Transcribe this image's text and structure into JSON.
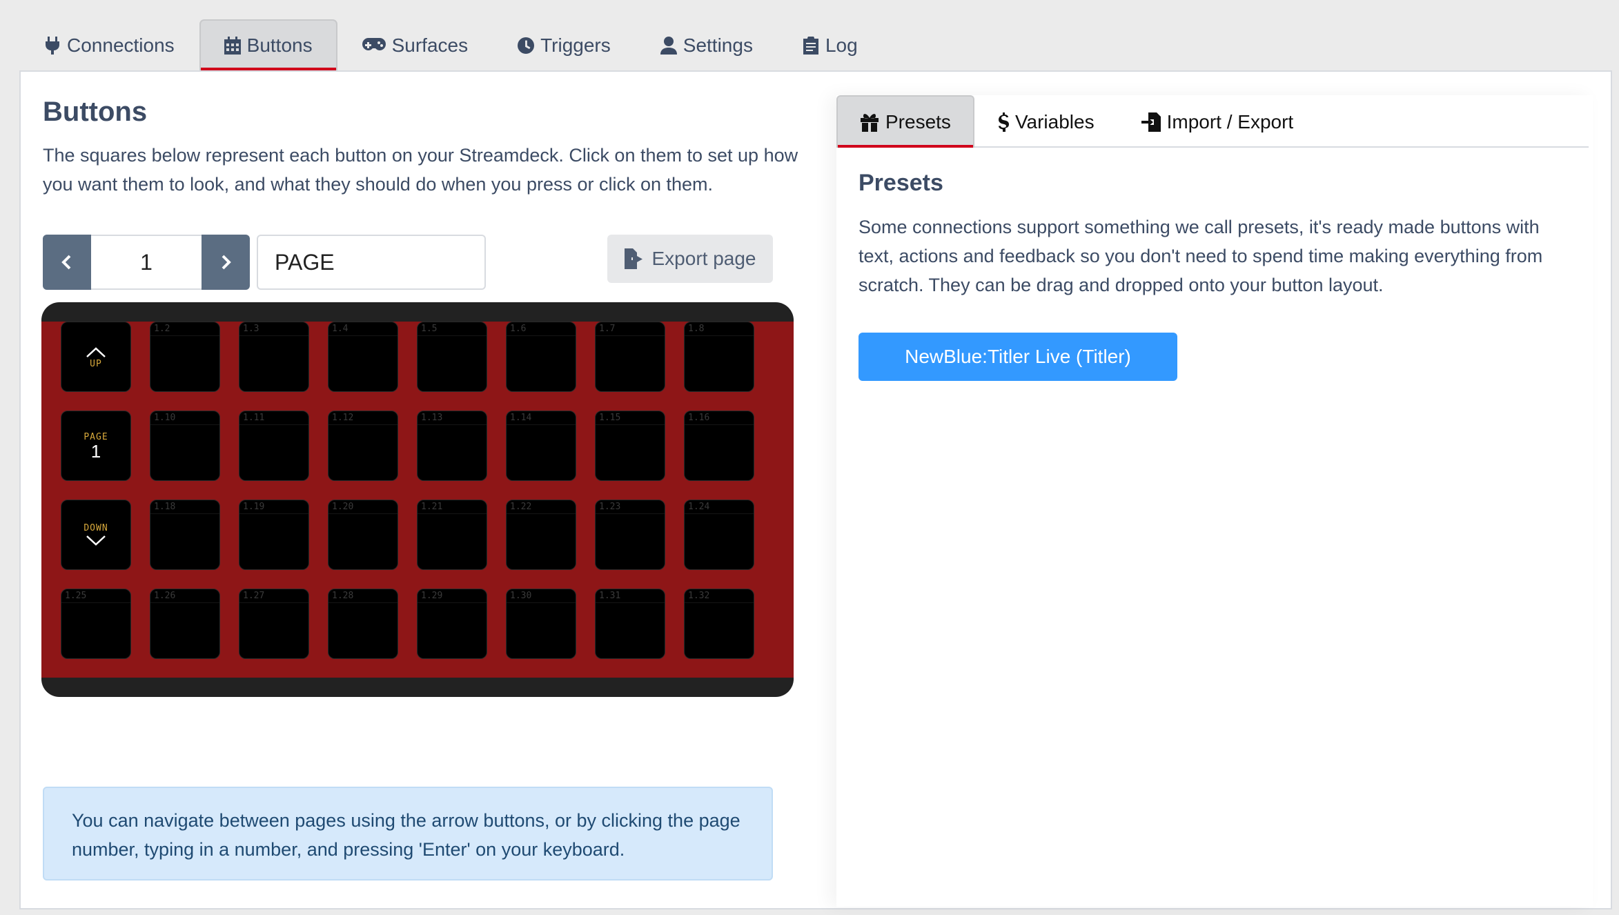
{
  "nav": {
    "tabs": [
      {
        "label": "Connections",
        "icon": "plug-icon",
        "active": false
      },
      {
        "label": "Buttons",
        "icon": "calendar-grid-icon",
        "active": true
      },
      {
        "label": "Surfaces",
        "icon": "gamepad-icon",
        "active": false
      },
      {
        "label": "Triggers",
        "icon": "clock-icon",
        "active": false
      },
      {
        "label": "Settings",
        "icon": "user-cog-icon",
        "active": false
      },
      {
        "label": "Log",
        "icon": "clipboard-icon",
        "active": false
      }
    ]
  },
  "buttons": {
    "title": "Buttons",
    "description": "The squares below represent each button on your Streamdeck. Click on them to set up how you want them to look, and what they should do when you press or click on them.",
    "page_number": "1",
    "page_name": "PAGE",
    "export_label": "Export page",
    "info": "You can navigate between pages using the arrow buttons, or by clicking the page number, typing in a number, and pressing 'Enter' on your keyboard."
  },
  "grid": {
    "up_label": "UP",
    "page_label": "PAGE",
    "page_value": "1",
    "down_label": "DOWN",
    "rows": [
      [
        "",
        "1.2",
        "1.3",
        "1.4",
        "1.5",
        "1.6",
        "1.7",
        "1.8"
      ],
      [
        "",
        "1.10",
        "1.11",
        "1.12",
        "1.13",
        "1.14",
        "1.15",
        "1.16"
      ],
      [
        "",
        "1.18",
        "1.19",
        "1.20",
        "1.21",
        "1.22",
        "1.23",
        "1.24"
      ],
      [
        "1.25",
        "1.26",
        "1.27",
        "1.28",
        "1.29",
        "1.30",
        "1.31",
        "1.32"
      ]
    ]
  },
  "right": {
    "tabs": [
      {
        "label": "Presets",
        "icon": "gift-icon",
        "active": true
      },
      {
        "label": "Variables",
        "icon": "dollar-icon",
        "active": false
      },
      {
        "label": "Import / Export",
        "icon": "file-import-icon",
        "active": false
      }
    ],
    "title": "Presets",
    "description": "Some connections support something we call presets, it's ready made buttons with text, actions and feedback so you don't need to spend time making everything from scratch. They can be drag and dropped onto your button layout.",
    "preset_button": "NewBlue:Titler Live (Titler)"
  },
  "colors": {
    "accent": "#d0021b",
    "deck_bg": "#8e1617",
    "primary": "#3399ff",
    "info_bg": "#d6e9fb"
  }
}
